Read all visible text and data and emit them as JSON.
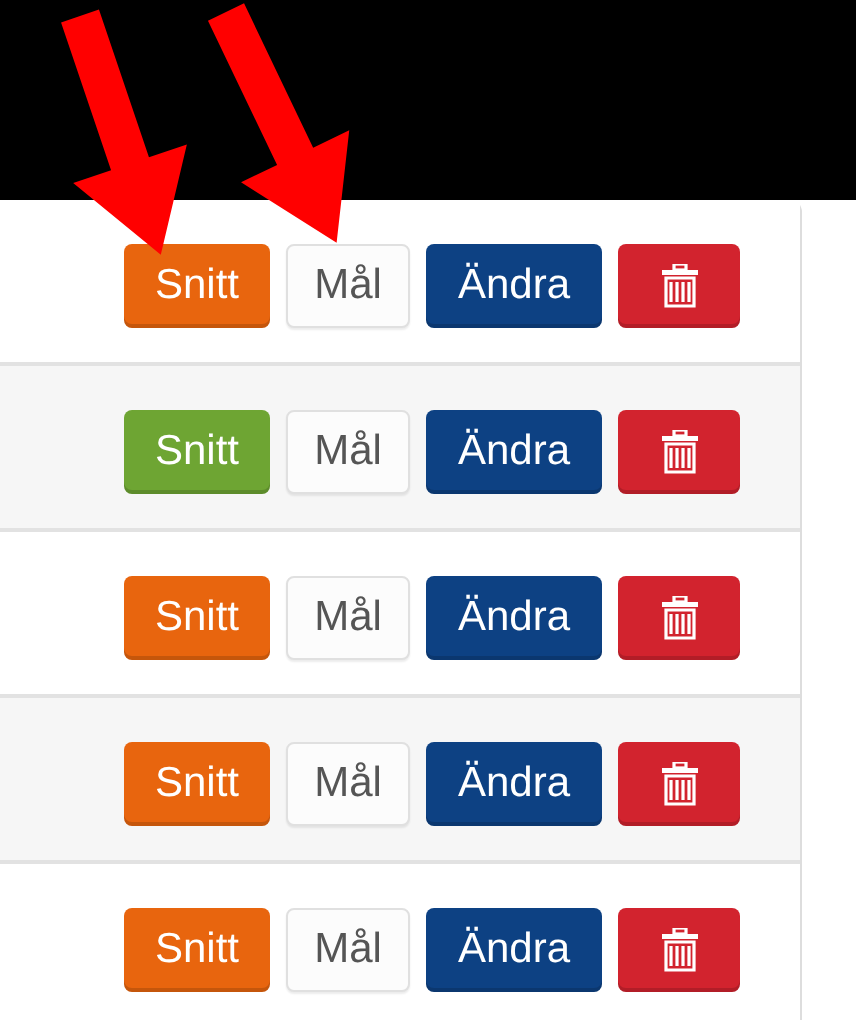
{
  "rows": [
    {
      "snitt": {
        "label": "Snitt",
        "color": "#e8650e"
      },
      "mal": "Mål",
      "andra": "Ändra"
    },
    {
      "snitt": {
        "label": "Snitt",
        "color": "#6ea533"
      },
      "mal": "Mål",
      "andra": "Ändra"
    },
    {
      "snitt": {
        "label": "Snitt",
        "color": "#e8650e"
      },
      "mal": "Mål",
      "andra": "Ändra"
    },
    {
      "snitt": {
        "label": "Snitt",
        "color": "#e8650e"
      },
      "mal": "Mål",
      "andra": "Ändra"
    },
    {
      "snitt": {
        "label": "Snitt",
        "color": "#e8650e"
      },
      "mal": "Mål",
      "andra": "Ändra"
    }
  ]
}
